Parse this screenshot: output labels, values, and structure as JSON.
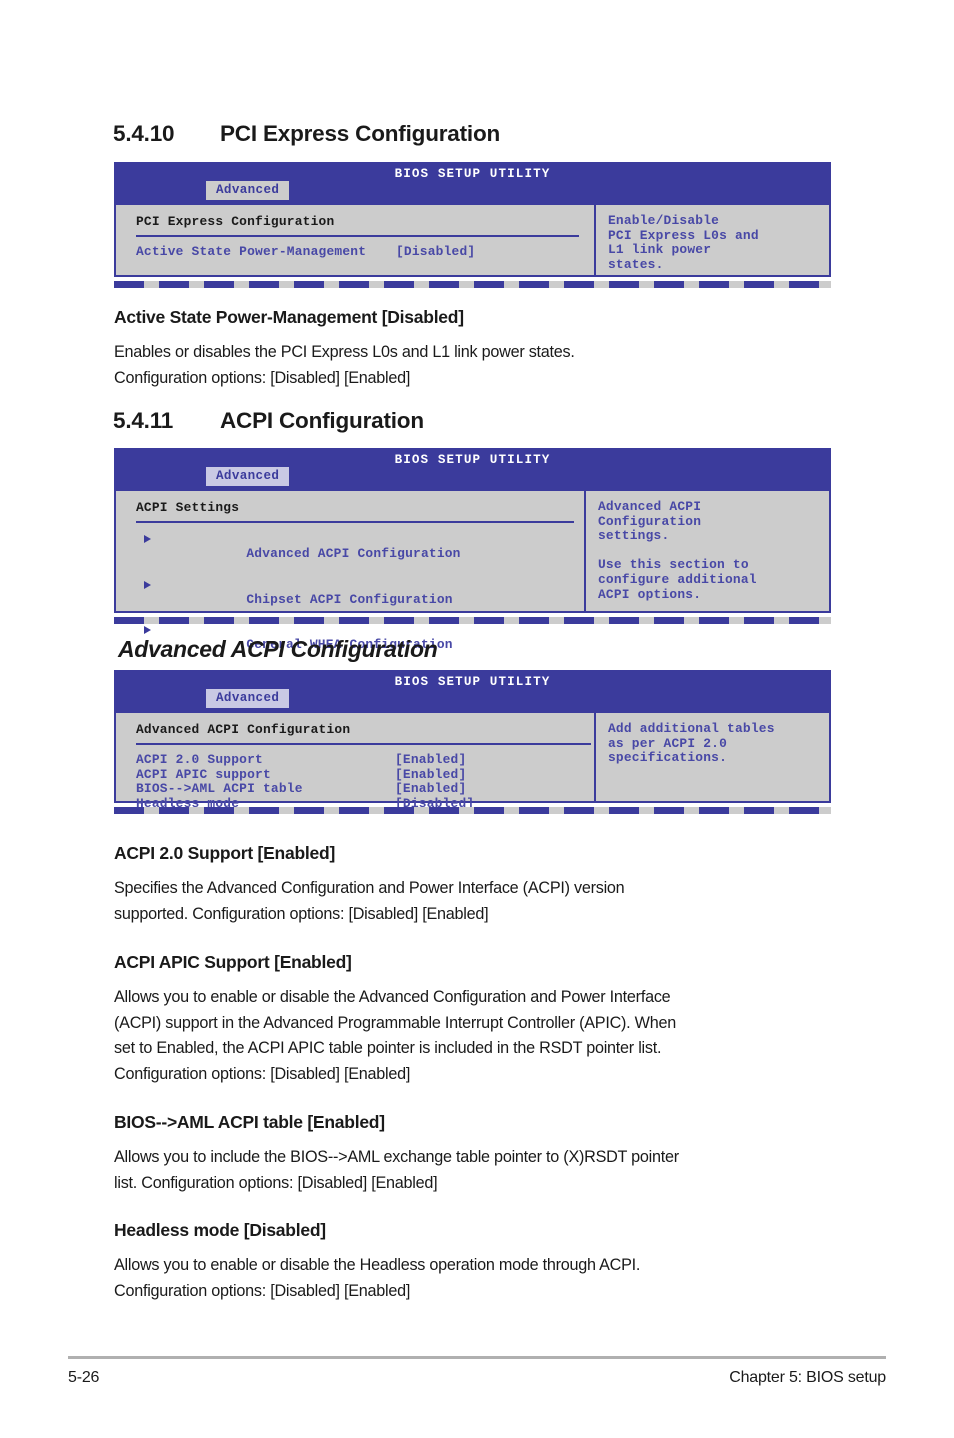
{
  "page": {
    "footer_page_number": "5-26",
    "footer_chapter": "Chapter 5: BIOS setup"
  },
  "sections": {
    "pci_express": {
      "number": "5.4.10",
      "title": "PCI Express Configuration"
    },
    "acpi_configuration": {
      "number": "5.4.11",
      "title": "ACPI Configuration"
    },
    "advanced_acpi": {
      "title": "Advanced ACPI Configuration"
    }
  },
  "bios_screens": [
    {
      "title": "BIOS SETUP UTILITY",
      "tab": "Advanced",
      "section_title": "PCI Express Configuration",
      "items": [
        {
          "label": "Active State Power-Management",
          "value": "[Disabled]"
        }
      ],
      "help": [
        "Enable/Disable",
        "PCI Express L0s and",
        "L1 link power",
        "states."
      ]
    },
    {
      "title": "BIOS SETUP UTILITY",
      "tab": "Advanced",
      "section_title": "ACPI Settings",
      "menu_items": [
        "Advanced ACPI Configuration",
        "Chipset ACPI Configuration",
        "General WHEA Configuration"
      ],
      "help": [
        "Advanced ACPI",
        "Configuration",
        "settings.",
        "",
        "Use this section to",
        "configure additional",
        "ACPI options."
      ]
    },
    {
      "title": "BIOS SETUP UTILITY",
      "tab": "Advanced",
      "section_title": "Advanced ACPI Configuration",
      "items": [
        {
          "label": "ACPI 2.0 Support",
          "value": "[Enabled]"
        },
        {
          "label": "ACPI APIC support",
          "value": "[Enabled]"
        },
        {
          "label": "BIOS-->AML ACPI table",
          "value": "[Enabled]"
        },
        {
          "label": "Headless mode",
          "value": "[Disabled]"
        }
      ],
      "help": [
        "Add additional tables",
        "as per ACPI 2.0",
        "specifications."
      ]
    }
  ],
  "descriptions": [
    {
      "heading": "Active State Power-Management [Disabled]",
      "lines": [
        "Enables or disables the PCI Express L0s and L1 link power states.",
        "Configuration options: [Disabled] [Enabled]"
      ]
    },
    {
      "heading": "ACPI 2.0 Support [Enabled]",
      "lines": [
        "Specifies the Advanced Configuration and Power Interface (ACPI) version",
        "supported. Configuration options: [Disabled] [Enabled]"
      ]
    },
    {
      "heading": "ACPI APIC Support [Enabled]",
      "lines": [
        "Allows you to enable or disable the Advanced Configuration and Power Interface",
        "(ACPI) support in the Advanced Programmable Interrupt Controller (APIC). When",
        "set to Enabled, the ACPI APIC table pointer is included in the RSDT pointer list.",
        "Configuration options: [Disabled] [Enabled]"
      ]
    },
    {
      "heading": "BIOS-->AML ACPI table [Enabled]",
      "lines": [
        "Allows you to include the BIOS-->AML exchange table pointer to (X)RSDT pointer",
        "list. Configuration options: [Disabled] [Enabled]"
      ]
    },
    {
      "heading": "Headless mode [Disabled]",
      "lines": [
        "Allows you to enable or disable the Headless operation mode through ACPI.",
        "Configuration options: [Disabled] [Enabled]"
      ]
    }
  ],
  "colors": {
    "bios_header_blue": "#3b3b9c",
    "bios_body_gray": "#cccccc",
    "bios_text_blue": "#4848a6",
    "text_black": "#1a1a1a"
  }
}
